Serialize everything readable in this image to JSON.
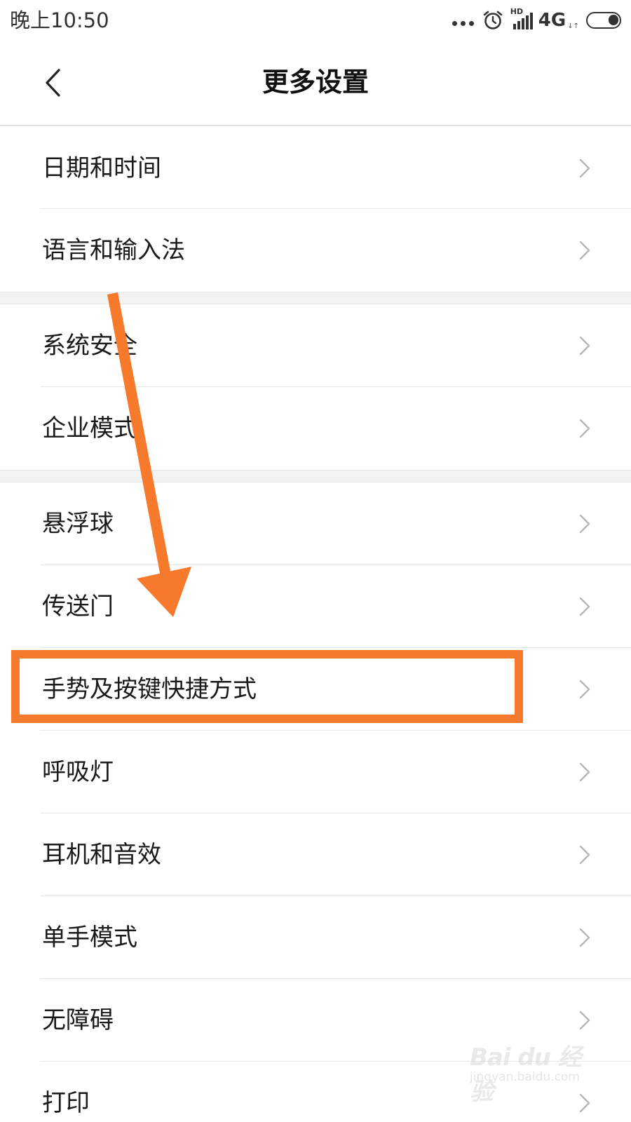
{
  "status_bar": {
    "time": "晚上10:50",
    "hd_label": "HD",
    "network_type": "4G",
    "network_arrows": "↓↑",
    "icons": [
      "more-dots-icon",
      "alarm-icon",
      "signal-icon",
      "battery-icon"
    ]
  },
  "header": {
    "title": "更多设置",
    "back_icon": "chevron-left-icon"
  },
  "menu": {
    "items": [
      {
        "label": "日期和时间"
      },
      {
        "label": "语言和输入法"
      },
      {
        "label": "系统安全"
      },
      {
        "label": "企业模式"
      },
      {
        "label": "悬浮球"
      },
      {
        "label": "传送门"
      },
      {
        "label": "手势及按键快捷方式"
      },
      {
        "label": "呼吸灯"
      },
      {
        "label": "耳机和音效"
      },
      {
        "label": "单手模式"
      },
      {
        "label": "无障碍"
      },
      {
        "label": "打印"
      }
    ],
    "chevron_icon": "chevron-right-icon"
  },
  "annotation": {
    "color": "#f6792c",
    "highlighted_item": "手势及按键快捷方式"
  },
  "watermark": {
    "logo": "Bai du 经验",
    "url": "jingyan.baidu.com"
  }
}
